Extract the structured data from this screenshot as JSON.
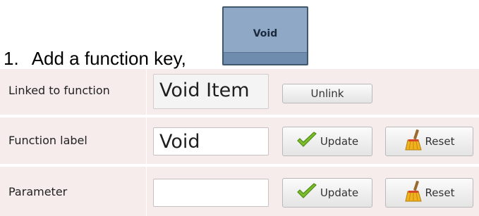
{
  "instruction": {
    "number": "1.",
    "text": "Add a function key,"
  },
  "function_key": {
    "label": "Void",
    "colors": {
      "face": "#8ea8c6",
      "border": "#40586f",
      "shade": "#6f8cae"
    }
  },
  "form": {
    "linked": {
      "label": "Linked to function",
      "value": "Void Item",
      "unlink_label": "Unlink"
    },
    "function_label": {
      "label": "Function label",
      "value": "Void",
      "update_label": "Update",
      "reset_label": "Reset"
    },
    "parameter": {
      "label": "Parameter",
      "value": "",
      "update_label": "Update",
      "reset_label": "Reset"
    }
  },
  "icons": [
    "checkmark-icon",
    "broom-icon"
  ]
}
